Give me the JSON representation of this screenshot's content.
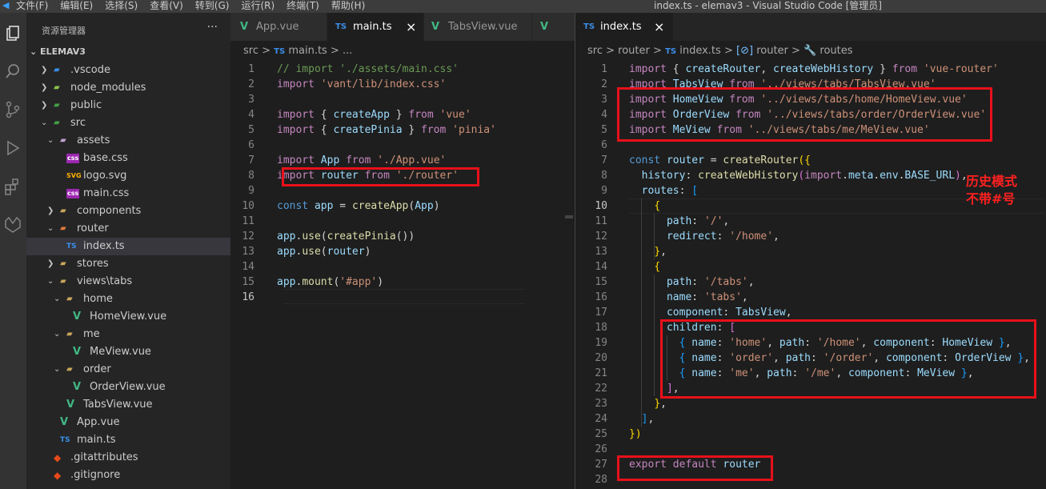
{
  "window": {
    "title": "index.ts - elemav3 - Visual Studio Code [管理员]",
    "menu": [
      "文件(F)",
      "编辑(E)",
      "选择(S)",
      "查看(V)",
      "转到(G)",
      "运行(R)",
      "终端(T)",
      "帮助(H)"
    ]
  },
  "activity_bar": [
    "files-icon",
    "search-icon",
    "source-control-icon",
    "run-debug-icon",
    "extensions-icon",
    "gitlens-icon"
  ],
  "sidebar": {
    "title": "资源管理器",
    "more": "···",
    "root": "ELEMAV3",
    "items": [
      {
        "label": ".vscode",
        "icon": "folder-vscode-icon"
      },
      {
        "label": "node_modules",
        "icon": "folder-node-icon"
      },
      {
        "label": "public",
        "icon": "folder-public-icon"
      },
      {
        "label": "src",
        "icon": "folder-src-icon"
      },
      {
        "label": "assets",
        "icon": "folder-assets-icon"
      },
      {
        "label": "base.css",
        "icon": "css-file-icon",
        "badge": "css"
      },
      {
        "label": "logo.svg",
        "icon": "svg-file-icon",
        "badge": "SVG"
      },
      {
        "label": "main.css",
        "icon": "css-file-icon",
        "badge": "css"
      },
      {
        "label": "components",
        "icon": "folder-components-icon"
      },
      {
        "label": "router",
        "icon": "folder-router-icon"
      },
      {
        "label": "index.ts",
        "icon": "ts-file-icon",
        "badge": "TS"
      },
      {
        "label": "stores",
        "icon": "folder-icon"
      },
      {
        "label": "views\\tabs",
        "icon": "folder-views-icon"
      },
      {
        "label": "home",
        "icon": "folder-icon"
      },
      {
        "label": "HomeView.vue",
        "icon": "vue-file-icon",
        "badge": "V"
      },
      {
        "label": "me",
        "icon": "folder-icon"
      },
      {
        "label": "MeView.vue",
        "icon": "vue-file-icon",
        "badge": "V"
      },
      {
        "label": "order",
        "icon": "folder-icon"
      },
      {
        "label": "OrderView.vue",
        "icon": "vue-file-icon",
        "badge": "V"
      },
      {
        "label": "TabsView.vue",
        "icon": "vue-file-icon",
        "badge": "V"
      },
      {
        "label": "App.vue",
        "icon": "vue-file-icon",
        "badge": "V"
      },
      {
        "label": "main.ts",
        "icon": "ts-file-icon",
        "badge": "TS"
      },
      {
        "label": ".gitattributes",
        "icon": "git-file-icon",
        "badge": "◆"
      },
      {
        "label": ".gitignore",
        "icon": "git-file-icon",
        "badge": "◆"
      }
    ]
  },
  "left_editor": {
    "tabs": [
      {
        "label": "App.vue",
        "badge": "V"
      },
      {
        "label": "main.ts",
        "badge": "TS",
        "close": "×"
      },
      {
        "label": "TabsView.vue",
        "badge": "V"
      },
      {
        "label": "",
        "badge": "V"
      }
    ],
    "breadcrumb": {
      "folder": "src",
      "sep": ">",
      "badge": "TS",
      "file": "main.ts",
      "tail": "..."
    },
    "line_numbers": [
      "1",
      "2",
      "3",
      "4",
      "5",
      "6",
      "7",
      "8",
      "9",
      "10",
      "11",
      "12",
      "13",
      "14",
      "15",
      "16"
    ],
    "lines": [
      [
        [
          "c",
          "// import './assets/main.css'"
        ]
      ],
      [
        [
          "k",
          "import "
        ],
        [
          "s",
          "'vant/lib/index.css'"
        ]
      ],
      [],
      [
        [
          "k",
          "import "
        ],
        [
          "d",
          "{ "
        ],
        [
          "v",
          "createApp"
        ],
        [
          "d",
          " } "
        ],
        [
          "k",
          "from "
        ],
        [
          "s",
          "'vue'"
        ]
      ],
      [
        [
          "k",
          "import "
        ],
        [
          "d",
          "{ "
        ],
        [
          "v",
          "createPinia"
        ],
        [
          "d",
          " } "
        ],
        [
          "k",
          "from "
        ],
        [
          "s",
          "'pinia'"
        ]
      ],
      [],
      [
        [
          "k",
          "import "
        ],
        [
          "v",
          "App "
        ],
        [
          "k",
          "from "
        ],
        [
          "s",
          "'./App.vue'"
        ]
      ],
      [
        [
          "k",
          "import "
        ],
        [
          "v",
          "router "
        ],
        [
          "k",
          "from "
        ],
        [
          "s",
          "'./router'"
        ]
      ],
      [],
      [
        [
          "b",
          "const "
        ],
        [
          "v",
          "app"
        ],
        [
          "d",
          " = "
        ],
        [
          "f",
          "createApp"
        ],
        [
          "d",
          "("
        ],
        [
          "v",
          "App"
        ],
        [
          "d",
          ")"
        ]
      ],
      [],
      [
        [
          "v",
          "app"
        ],
        [
          "d",
          "."
        ],
        [
          "f",
          "use"
        ],
        [
          "d",
          "("
        ],
        [
          "f",
          "createPinia"
        ],
        [
          "d",
          "())"
        ]
      ],
      [
        [
          "v",
          "app"
        ],
        [
          "d",
          "."
        ],
        [
          "f",
          "use"
        ],
        [
          "d",
          "("
        ],
        [
          "v",
          "router"
        ],
        [
          "d",
          ")"
        ]
      ],
      [],
      [
        [
          "v",
          "app"
        ],
        [
          "d",
          "."
        ],
        [
          "f",
          "mount"
        ],
        [
          "d",
          "("
        ],
        [
          "s",
          "'#app'"
        ],
        [
          "d",
          ")"
        ]
      ],
      []
    ]
  },
  "right_editor": {
    "tab": {
      "label": "index.ts",
      "badge": "TS",
      "close": "×"
    },
    "breadcrumb": {
      "src": "src",
      "router": "router",
      "badge": "TS",
      "file": "index.ts",
      "sym1": "router",
      "sym2": "routes"
    },
    "line_numbers": [
      "1",
      "2",
      "3",
      "4",
      "5",
      "6",
      "7",
      "8",
      "9",
      "10",
      "11",
      "12",
      "13",
      "14",
      "15",
      "16",
      "17",
      "18",
      "19",
      "20",
      "21",
      "22",
      "23",
      "24",
      "25",
      "26",
      "27",
      "28"
    ],
    "lines": [
      [
        [
          "k",
          "import "
        ],
        [
          "d",
          "{ "
        ],
        [
          "v",
          "createRouter"
        ],
        [
          "d",
          ", "
        ],
        [
          "v",
          "createWebHistory"
        ],
        [
          "d",
          " } "
        ],
        [
          "k",
          "from "
        ],
        [
          "s",
          "'vue-router'"
        ]
      ],
      [
        [
          "k",
          "import "
        ],
        [
          "v",
          "TabsView "
        ],
        [
          "k",
          "from "
        ],
        [
          "s",
          "'../views/tabs/TabsView.vue'"
        ]
      ],
      [
        [
          "k",
          "import "
        ],
        [
          "v",
          "HomeView "
        ],
        [
          "k",
          "from "
        ],
        [
          "s",
          "'../views/tabs/home/HomeView.vue'"
        ]
      ],
      [
        [
          "k",
          "import "
        ],
        [
          "v",
          "OrderView "
        ],
        [
          "k",
          "from "
        ],
        [
          "s",
          "'../views/tabs/order/OrderView.vue'"
        ]
      ],
      [
        [
          "k",
          "import "
        ],
        [
          "v",
          "MeView "
        ],
        [
          "k",
          "from "
        ],
        [
          "s",
          "'../views/tabs/me/MeView.vue'"
        ]
      ],
      [],
      [
        [
          "b",
          "const "
        ],
        [
          "v",
          "router"
        ],
        [
          "d",
          " = "
        ],
        [
          "f",
          "createRouter"
        ],
        [
          "y",
          "({"
        ]
      ],
      [
        [
          "d",
          "  "
        ],
        [
          "v",
          "history"
        ],
        [
          "d",
          ": "
        ],
        [
          "f",
          "createWebHistory"
        ],
        [
          "p",
          "("
        ],
        [
          "k",
          "import"
        ],
        [
          "d",
          "."
        ],
        [
          "v",
          "meta"
        ],
        [
          "d",
          "."
        ],
        [
          "v",
          "env"
        ],
        [
          "d",
          "."
        ],
        [
          "v",
          "BASE_URL"
        ],
        [
          "p",
          ")"
        ],
        [
          "d",
          ","
        ]
      ],
      [
        [
          "d",
          "  "
        ],
        [
          "v",
          "routes"
        ],
        [
          "d",
          ": "
        ],
        [
          "bl",
          "["
        ]
      ],
      [
        [
          "d",
          "    "
        ],
        [
          "y",
          "{"
        ]
      ],
      [
        [
          "d",
          "      "
        ],
        [
          "v",
          "path"
        ],
        [
          "d",
          ": "
        ],
        [
          "s",
          "'/'"
        ],
        [
          "d",
          ","
        ]
      ],
      [
        [
          "d",
          "      "
        ],
        [
          "v",
          "redirect"
        ],
        [
          "d",
          ": "
        ],
        [
          "s",
          "'/home'"
        ],
        [
          "d",
          ","
        ]
      ],
      [
        [
          "d",
          "    "
        ],
        [
          "y",
          "}"
        ],
        [
          "d",
          ","
        ]
      ],
      [
        [
          "d",
          "    "
        ],
        [
          "y",
          "{"
        ]
      ],
      [
        [
          "d",
          "      "
        ],
        [
          "v",
          "path"
        ],
        [
          "d",
          ": "
        ],
        [
          "s",
          "'/tabs'"
        ],
        [
          "d",
          ","
        ]
      ],
      [
        [
          "d",
          "      "
        ],
        [
          "v",
          "name"
        ],
        [
          "d",
          ": "
        ],
        [
          "s",
          "'tabs'"
        ],
        [
          "d",
          ","
        ]
      ],
      [
        [
          "d",
          "      "
        ],
        [
          "v",
          "component"
        ],
        [
          "d",
          ": "
        ],
        [
          "v",
          "TabsView"
        ],
        [
          "d",
          ","
        ]
      ],
      [
        [
          "d",
          "      "
        ],
        [
          "v",
          "children"
        ],
        [
          "d",
          ": "
        ],
        [
          "p",
          "["
        ]
      ],
      [
        [
          "d",
          "        "
        ],
        [
          "bl",
          "{ "
        ],
        [
          "v",
          "name"
        ],
        [
          "d",
          ": "
        ],
        [
          "s",
          "'home'"
        ],
        [
          "d",
          ", "
        ],
        [
          "v",
          "path"
        ],
        [
          "d",
          ": "
        ],
        [
          "s",
          "'/home'"
        ],
        [
          "d",
          ", "
        ],
        [
          "v",
          "component"
        ],
        [
          "d",
          ": "
        ],
        [
          "v",
          "HomeView"
        ],
        [
          "bl",
          " }"
        ],
        [
          "d",
          ","
        ]
      ],
      [
        [
          "d",
          "        "
        ],
        [
          "bl",
          "{ "
        ],
        [
          "v",
          "name"
        ],
        [
          "d",
          ": "
        ],
        [
          "s",
          "'order'"
        ],
        [
          "d",
          ", "
        ],
        [
          "v",
          "path"
        ],
        [
          "d",
          ": "
        ],
        [
          "s",
          "'/order'"
        ],
        [
          "d",
          ", "
        ],
        [
          "v",
          "component"
        ],
        [
          "d",
          ": "
        ],
        [
          "v",
          "OrderView"
        ],
        [
          "bl",
          " }"
        ],
        [
          "d",
          ","
        ]
      ],
      [
        [
          "d",
          "        "
        ],
        [
          "bl",
          "{ "
        ],
        [
          "v",
          "name"
        ],
        [
          "d",
          ": "
        ],
        [
          "s",
          "'me'"
        ],
        [
          "d",
          ", "
        ],
        [
          "v",
          "path"
        ],
        [
          "d",
          ": "
        ],
        [
          "s",
          "'/me'"
        ],
        [
          "d",
          ", "
        ],
        [
          "v",
          "component"
        ],
        [
          "d",
          ": "
        ],
        [
          "v",
          "MeView"
        ],
        [
          "bl",
          " }"
        ],
        [
          "d",
          ","
        ]
      ],
      [
        [
          "d",
          "      "
        ],
        [
          "p",
          "]"
        ],
        [
          "d",
          ","
        ]
      ],
      [
        [
          "d",
          "    "
        ],
        [
          "y",
          "}"
        ],
        [
          "d",
          ","
        ]
      ],
      [
        [
          "d",
          "  "
        ],
        [
          "bl",
          "]"
        ],
        [
          "d",
          ","
        ]
      ],
      [
        [
          "y",
          "})"
        ]
      ],
      [],
      [
        [
          "k",
          "export "
        ],
        [
          "k",
          "default "
        ],
        [
          "v",
          "router"
        ]
      ],
      []
    ]
  },
  "annotation": {
    "line1": "历史模式",
    "line2": "不带#号"
  },
  "colors": {
    "highlight_box": "#e8101a",
    "annotation_text": "#ff2020"
  }
}
